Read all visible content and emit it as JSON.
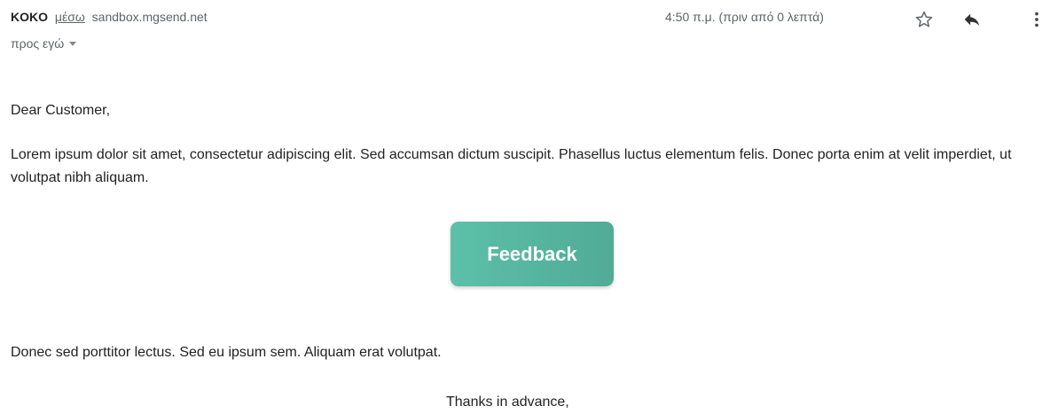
{
  "email": {
    "sender_name": "KOKO",
    "via_label": "μέσω",
    "sender_domain": "sandbox.mgsend.net",
    "timestamp": "4:50 π.μ. (πριν από 0 λεπτά)",
    "recipient": "προς εγώ",
    "greeting": "Dear Customer,",
    "paragraph1": "Lorem ipsum dolor sit amet, consectetur adipiscing elit. Sed accumsan dictum suscipit. Phasellus luctus elementum felis. Donec porta enim at velit imperdiet, ut volutpat nibh aliquam.",
    "button_label": "Feedback",
    "paragraph2": "Donec sed porttitor lectus. Sed eu ipsum sem. Aliquam erat volutpat.",
    "closing": "Thanks in advance,"
  },
  "icons": {
    "star": "star-icon",
    "reply": "reply-icon",
    "more": "more-vertical-icon",
    "recipient_dropdown": "caret-down-icon"
  },
  "colors": {
    "button_start": "#5cc0a8",
    "button_end": "#51ab96",
    "button_text": "#ffffff",
    "meta_text": "#5f6368"
  }
}
